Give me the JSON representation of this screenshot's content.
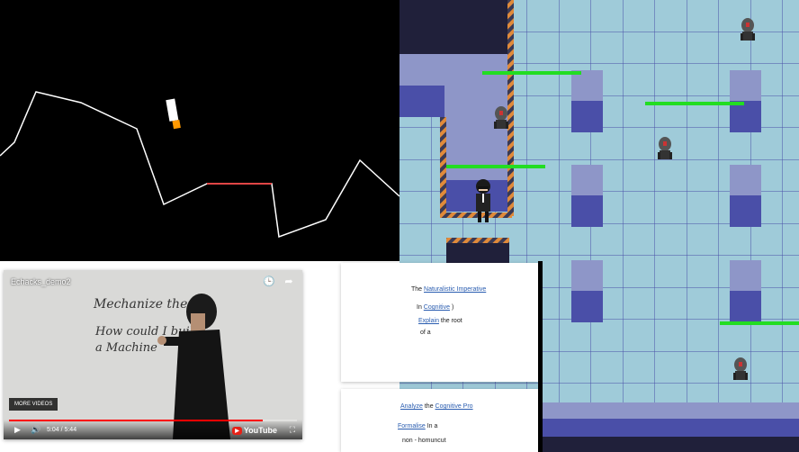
{
  "lander_colors": {
    "terrain": "#ffffff",
    "landing_pad": "#ff3333",
    "ship_body": "#ffffff",
    "ship_flame": "#ff9900"
  },
  "video": {
    "title": "Echacks_demo2",
    "watch_later_icon": "clock-icon",
    "share_icon": "share-icon",
    "more_videos_label": "MORE VIDEOS",
    "time_display": "5:04 / 5:44",
    "progress": 0.88,
    "brand": "YouTube",
    "whiteboard_lines": [
      "Mechanize the pr",
      "How could I buil",
      "a Machine"
    ]
  },
  "card1": {
    "line1_prefix": "The",
    "line1_link": "Naturalistic Imperative",
    "line2_prefix": "In",
    "line2_link": "Cognitive",
    "line2_suffix": ")",
    "line3_link": "Explain",
    "line3_suffix": "the root",
    "line4": "of a"
  },
  "card2": {
    "line1_link": "Analyze",
    "line1_mid": "the",
    "line1_link2": "Cognitive Pro",
    "line2_link": "Formalise",
    "line2_suffix": "In a",
    "line3": "non - homuncut"
  },
  "game_colors": {
    "floor": "#9fcbd9",
    "wall_top": "#8e96c8",
    "wall_side": "#4a4fa8",
    "hazard_stripe": "#e08a3a",
    "health_bar": "#22dd22"
  }
}
